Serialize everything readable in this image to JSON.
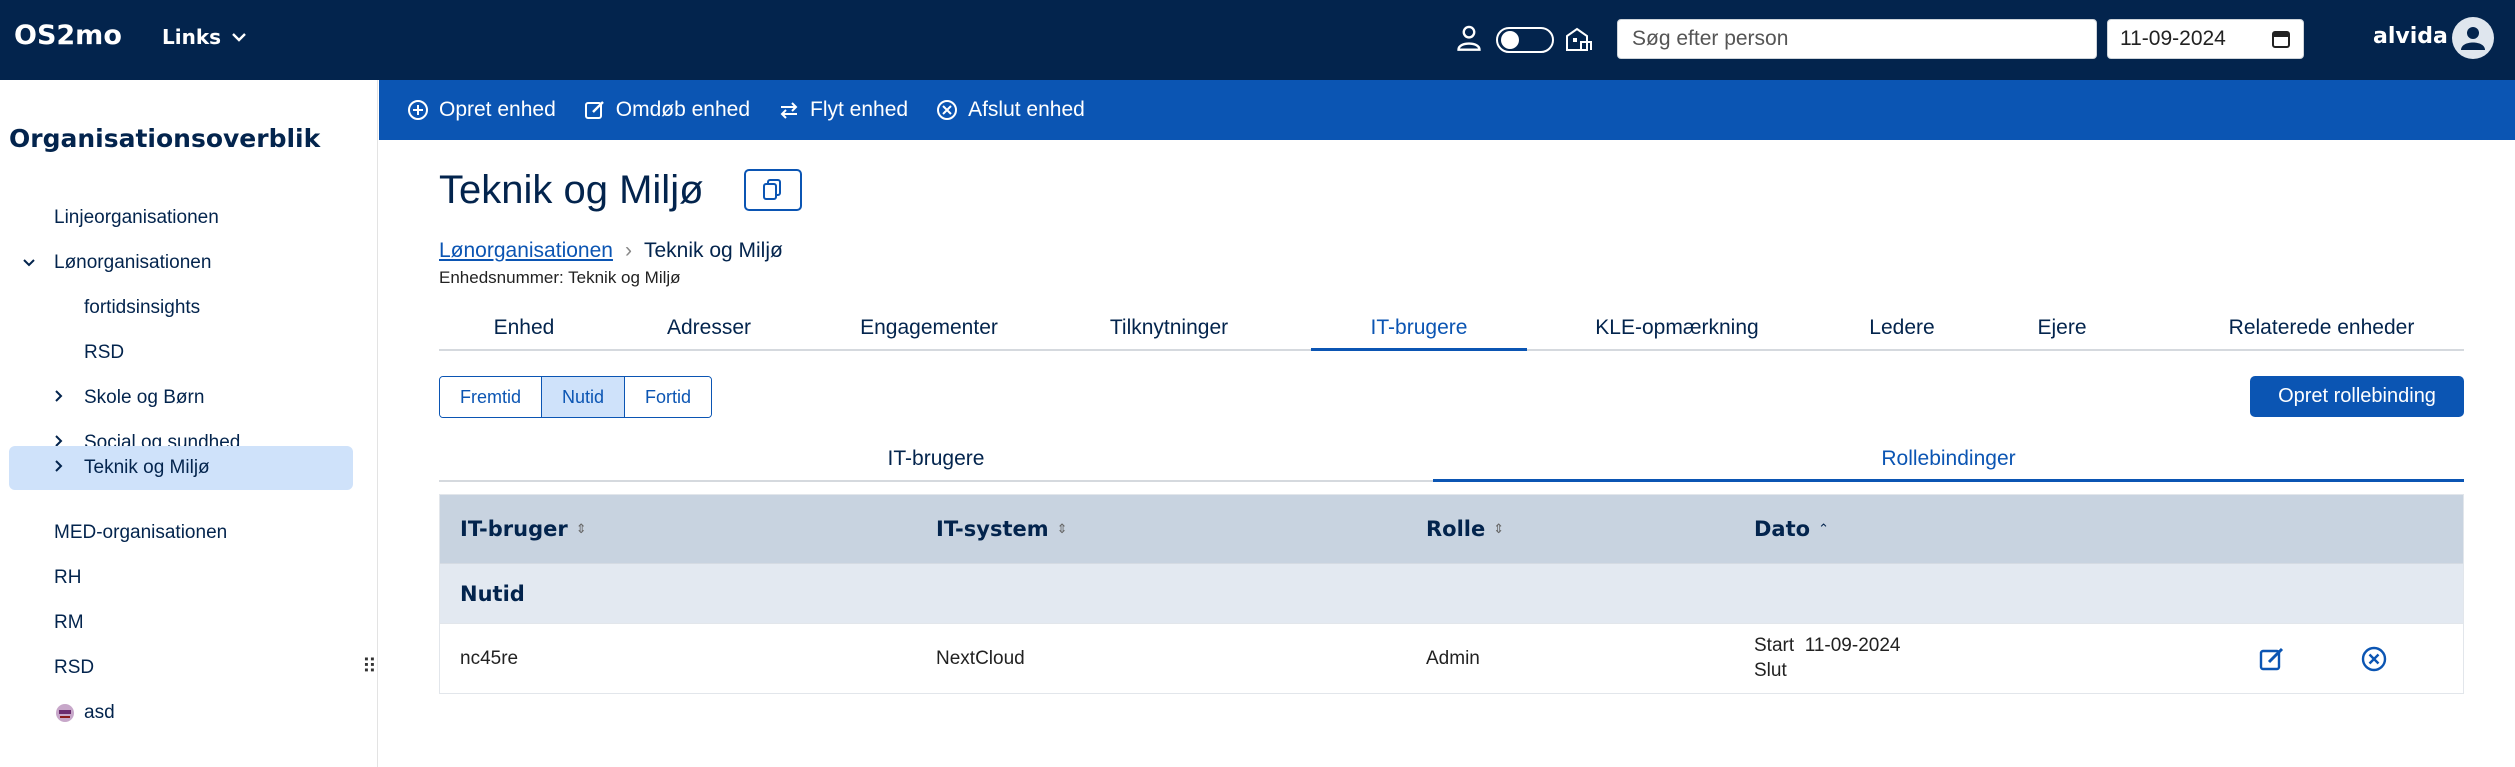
{
  "topbar": {
    "brand": "OS2mo",
    "links_label": "Links",
    "search_placeholder": "Søg efter person",
    "date_value": "11-09-2024",
    "username": "alvida"
  },
  "sidebar": {
    "title": "Organisationsoverblik",
    "items": [
      {
        "label": "Linjeorganisationen"
      },
      {
        "label": "Lønorganisationen"
      },
      {
        "label": "fortidsinsights"
      },
      {
        "label": "RSD"
      },
      {
        "label": "Skole og Børn"
      },
      {
        "label": "Social og sundhed"
      },
      {
        "label": "Teknik og Miljø"
      },
      {
        "label": "MED-organisationen"
      },
      {
        "label": "RH"
      },
      {
        "label": "RM"
      },
      {
        "label": "RSD"
      },
      {
        "label": "asd"
      }
    ]
  },
  "actions": {
    "create": "Opret enhed",
    "rename": "Omdøb enhed",
    "move": "Flyt enhed",
    "end": "Afslut enhed"
  },
  "main": {
    "title": "Teknik og Miljø",
    "breadcrumb": {
      "parent": "Lønorganisationen",
      "separator": "›",
      "current": "Teknik og Miljø"
    },
    "unit_number": "Enhedsnummer: Teknik og Miljø",
    "tabs": [
      "Enhed",
      "Adresser",
      "Engagementer",
      "Tilknytninger",
      "IT-brugere",
      "KLE-opmærkning",
      "Ledere",
      "Ejere",
      "Relaterede enheder"
    ],
    "active_tab": "IT-brugere",
    "time_filter": [
      "Fremtid",
      "Nutid",
      "Fortid"
    ],
    "active_filter": "Nutid",
    "create_rolebinding": "Opret rollebinding",
    "subtabs": [
      "IT-brugere",
      "Rollebindinger"
    ],
    "active_subtab": "Rollebindinger"
  },
  "table": {
    "headers": [
      "IT-bruger",
      "IT-system",
      "Rolle",
      "Dato"
    ],
    "group_label": "Nutid",
    "rows": [
      {
        "it_user": "nc45re",
        "it_system": "NextCloud",
        "role": "Admin",
        "start_label": "Start",
        "start_date": "11-09-2024",
        "end_label": "Slut",
        "end_date": ""
      }
    ]
  }
}
